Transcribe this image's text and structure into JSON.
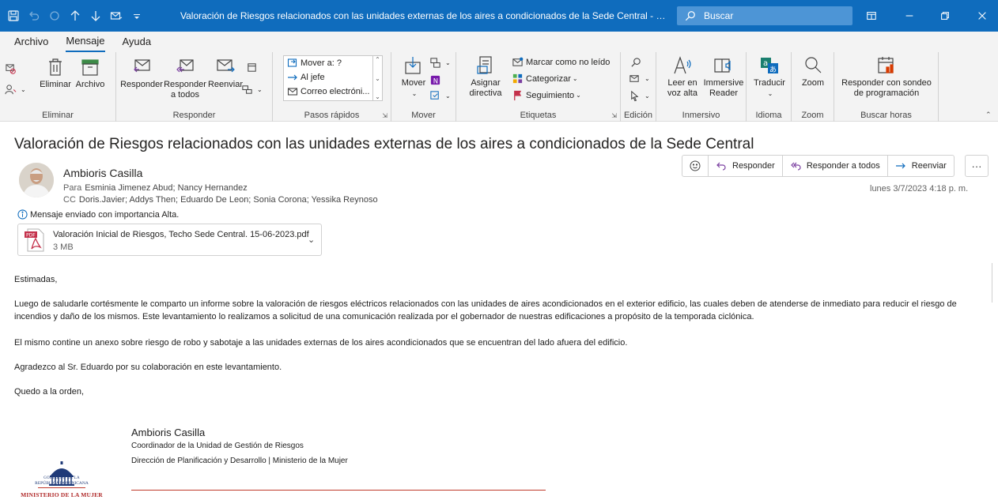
{
  "titlebar": {
    "title": "Valoración de Riesgos relacionados con las unidades externas de los aires a condicionados de la Sede Central  -  Mensaje (...",
    "search_placeholder": "Buscar"
  },
  "tabs": [
    {
      "label": "Archivo",
      "active": false
    },
    {
      "label": "Mensaje",
      "active": true
    },
    {
      "label": "Ayuda",
      "active": false
    }
  ],
  "ribbon": {
    "eliminar": {
      "delete_label": "Eliminar",
      "archive_label": "Archivo",
      "group": "Eliminar"
    },
    "responder": {
      "reply_label": "Responder",
      "reply_all_label": "Responder a todos",
      "forward_label": "Reenviar",
      "group": "Responder"
    },
    "pasos": {
      "items": [
        "Mover a: ?",
        "Al jefe",
        "Correo electróni..."
      ],
      "group": "Pasos rápidos"
    },
    "mover": {
      "move_label": "Mover",
      "group": "Mover"
    },
    "etiquetas": {
      "assign_label": "Asignar directiva",
      "unread_label": "Marcar como no leído",
      "categorize_label": "Categorizar",
      "followup_label": "Seguimiento",
      "group": "Etiquetas"
    },
    "edicion": {
      "group": "Edición"
    },
    "inmersivo": {
      "read_aloud_label": "Leer en voz alta",
      "immersive_label": "Immersive Reader",
      "group": "Inmersivo"
    },
    "idioma": {
      "translate_label": "Traducir",
      "group": "Idioma"
    },
    "zoom": {
      "zoom_label": "Zoom",
      "group": "Zoom"
    },
    "buscar": {
      "poll_label": "Responder con sondeo de programación",
      "group": "Buscar horas"
    }
  },
  "message": {
    "subject": "Valoración de Riesgos relacionados con las unidades externas de los aires a condicionados de la Sede Central",
    "sender": "Ambioris Casilla",
    "to_key": "Para",
    "to": "Esminia Jimenez Abud; Nancy Hernandez",
    "cc_key": "CC",
    "cc": "Doris.Javier; Addys Then; Eduardo De Leon; Sonia Corona; Yessika Reynoso",
    "importance": "Mensaje enviado con importancia Alta.",
    "date": "lunes 3/7/2023 4:18 p. m.",
    "attachment": {
      "name": "Valoración Inicial de Riesgos, Techo Sede Central. 15-06-2023.pdf",
      "size": "3 MB",
      "type_label": "PDF"
    },
    "actions": {
      "reply": "Responder",
      "reply_all": "Responder a todos",
      "forward": "Reenviar",
      "more": "···"
    }
  },
  "body": {
    "greeting": "Estimadas,",
    "p1": "Luego de saludarle cortésmente le comparto un informe sobre la valoración de riesgos eléctricos relacionados con las unidades de aires acondicionados en el exterior edificio, las cuales deben de atenderse de inmediato para reducir el riesgo de incendios y daño de los mismos.  Este levantamiento lo realizamos a solicitud de una comunicación realizada por el gobernador de nuestras edificaciones a propósito de la temporada ciclónica.",
    "p2": "El mismo contine un anexo sobre riesgo de robo y sabotaje a las unidades externas de los aires acondicionados que se encuentran del lado afuera del edificio.",
    "p3": "Agradezco al Sr. Eduardo por su colaboración en este levantamiento.",
    "closing": "Quedo a la orden,"
  },
  "signature": {
    "name": "Ambioris Casilla",
    "title": "Coordinador de la Unidad de Gestión de Riesgos",
    "dept": "Dirección de Planificación y Desarrollo | Ministerio de la Mujer",
    "logo_line1": "GOBIERNO DE LA",
    "logo_line2": "REPÚBLICA DOMINICANA",
    "logo_line3": "MINISTERIO DE LA MUJER"
  },
  "colors": {
    "accent": "#0f6cbd",
    "ribbon_bg": "#f3f3f3",
    "flag": "#c4314b"
  }
}
